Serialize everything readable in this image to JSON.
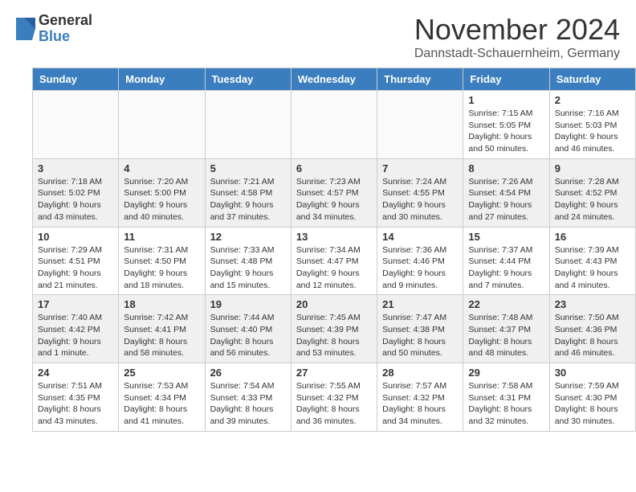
{
  "header": {
    "logo_general": "General",
    "logo_blue": "Blue",
    "month_title": "November 2024",
    "location": "Dannstadt-Schauernheim, Germany"
  },
  "days_of_week": [
    "Sunday",
    "Monday",
    "Tuesday",
    "Wednesday",
    "Thursday",
    "Friday",
    "Saturday"
  ],
  "weeks": [
    [
      {
        "day": "",
        "info": ""
      },
      {
        "day": "",
        "info": ""
      },
      {
        "day": "",
        "info": ""
      },
      {
        "day": "",
        "info": ""
      },
      {
        "day": "",
        "info": ""
      },
      {
        "day": "1",
        "info": "Sunrise: 7:15 AM\nSunset: 5:05 PM\nDaylight: 9 hours and 50 minutes."
      },
      {
        "day": "2",
        "info": "Sunrise: 7:16 AM\nSunset: 5:03 PM\nDaylight: 9 hours and 46 minutes."
      }
    ],
    [
      {
        "day": "3",
        "info": "Sunrise: 7:18 AM\nSunset: 5:02 PM\nDaylight: 9 hours and 43 minutes."
      },
      {
        "day": "4",
        "info": "Sunrise: 7:20 AM\nSunset: 5:00 PM\nDaylight: 9 hours and 40 minutes."
      },
      {
        "day": "5",
        "info": "Sunrise: 7:21 AM\nSunset: 4:58 PM\nDaylight: 9 hours and 37 minutes."
      },
      {
        "day": "6",
        "info": "Sunrise: 7:23 AM\nSunset: 4:57 PM\nDaylight: 9 hours and 34 minutes."
      },
      {
        "day": "7",
        "info": "Sunrise: 7:24 AM\nSunset: 4:55 PM\nDaylight: 9 hours and 30 minutes."
      },
      {
        "day": "8",
        "info": "Sunrise: 7:26 AM\nSunset: 4:54 PM\nDaylight: 9 hours and 27 minutes."
      },
      {
        "day": "9",
        "info": "Sunrise: 7:28 AM\nSunset: 4:52 PM\nDaylight: 9 hours and 24 minutes."
      }
    ],
    [
      {
        "day": "10",
        "info": "Sunrise: 7:29 AM\nSunset: 4:51 PM\nDaylight: 9 hours and 21 minutes."
      },
      {
        "day": "11",
        "info": "Sunrise: 7:31 AM\nSunset: 4:50 PM\nDaylight: 9 hours and 18 minutes."
      },
      {
        "day": "12",
        "info": "Sunrise: 7:33 AM\nSunset: 4:48 PM\nDaylight: 9 hours and 15 minutes."
      },
      {
        "day": "13",
        "info": "Sunrise: 7:34 AM\nSunset: 4:47 PM\nDaylight: 9 hours and 12 minutes."
      },
      {
        "day": "14",
        "info": "Sunrise: 7:36 AM\nSunset: 4:46 PM\nDaylight: 9 hours and 9 minutes."
      },
      {
        "day": "15",
        "info": "Sunrise: 7:37 AM\nSunset: 4:44 PM\nDaylight: 9 hours and 7 minutes."
      },
      {
        "day": "16",
        "info": "Sunrise: 7:39 AM\nSunset: 4:43 PM\nDaylight: 9 hours and 4 minutes."
      }
    ],
    [
      {
        "day": "17",
        "info": "Sunrise: 7:40 AM\nSunset: 4:42 PM\nDaylight: 9 hours and 1 minute."
      },
      {
        "day": "18",
        "info": "Sunrise: 7:42 AM\nSunset: 4:41 PM\nDaylight: 8 hours and 58 minutes."
      },
      {
        "day": "19",
        "info": "Sunrise: 7:44 AM\nSunset: 4:40 PM\nDaylight: 8 hours and 56 minutes."
      },
      {
        "day": "20",
        "info": "Sunrise: 7:45 AM\nSunset: 4:39 PM\nDaylight: 8 hours and 53 minutes."
      },
      {
        "day": "21",
        "info": "Sunrise: 7:47 AM\nSunset: 4:38 PM\nDaylight: 8 hours and 50 minutes."
      },
      {
        "day": "22",
        "info": "Sunrise: 7:48 AM\nSunset: 4:37 PM\nDaylight: 8 hours and 48 minutes."
      },
      {
        "day": "23",
        "info": "Sunrise: 7:50 AM\nSunset: 4:36 PM\nDaylight: 8 hours and 46 minutes."
      }
    ],
    [
      {
        "day": "24",
        "info": "Sunrise: 7:51 AM\nSunset: 4:35 PM\nDaylight: 8 hours and 43 minutes."
      },
      {
        "day": "25",
        "info": "Sunrise: 7:53 AM\nSunset: 4:34 PM\nDaylight: 8 hours and 41 minutes."
      },
      {
        "day": "26",
        "info": "Sunrise: 7:54 AM\nSunset: 4:33 PM\nDaylight: 8 hours and 39 minutes."
      },
      {
        "day": "27",
        "info": "Sunrise: 7:55 AM\nSunset: 4:32 PM\nDaylight: 8 hours and 36 minutes."
      },
      {
        "day": "28",
        "info": "Sunrise: 7:57 AM\nSunset: 4:32 PM\nDaylight: 8 hours and 34 minutes."
      },
      {
        "day": "29",
        "info": "Sunrise: 7:58 AM\nSunset: 4:31 PM\nDaylight: 8 hours and 32 minutes."
      },
      {
        "day": "30",
        "info": "Sunrise: 7:59 AM\nSunset: 4:30 PM\nDaylight: 8 hours and 30 minutes."
      }
    ]
  ]
}
